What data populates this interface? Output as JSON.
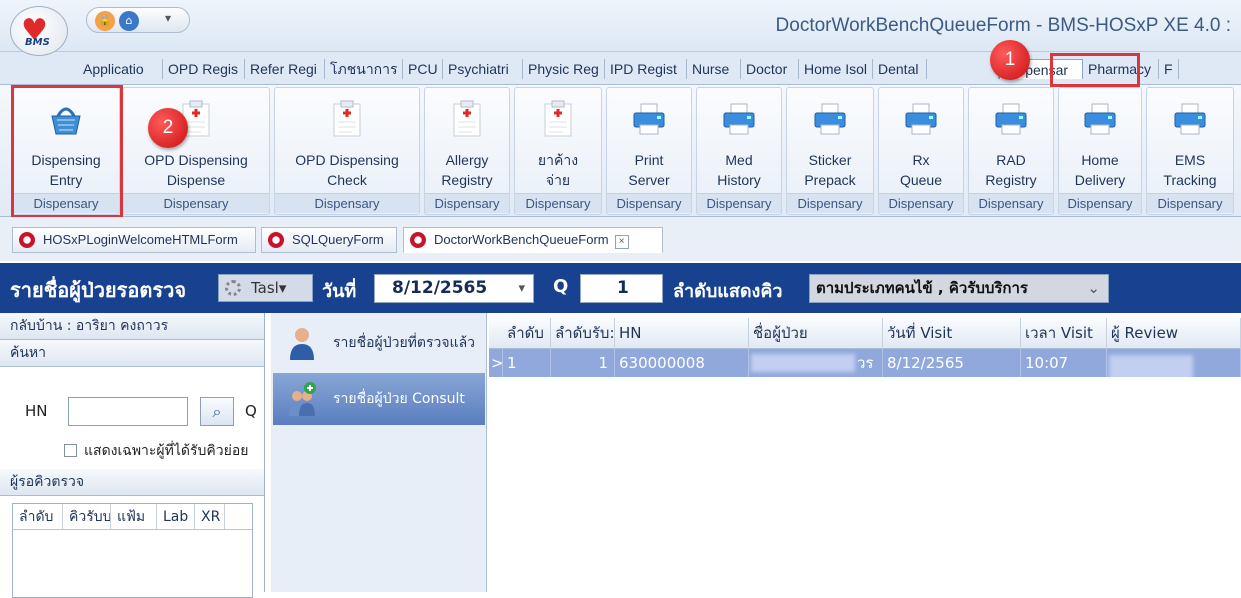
{
  "app": {
    "logo_text": "BMS",
    "window_title": "DoctorWorkBenchQueueForm - BMS-HOSxP XE 4.0 :"
  },
  "ribbon_tabs": [
    {
      "label": "Applicatio",
      "w": 85
    },
    {
      "label": "OPD Regis",
      "w": 82
    },
    {
      "label": "Refer Regi",
      "w": 80
    },
    {
      "label": "โภชนาการ",
      "w": 78
    },
    {
      "label": "PCU",
      "w": 40
    },
    {
      "label": "Psychiatri",
      "w": 80
    },
    {
      "label": "Physic Reg",
      "w": 82
    },
    {
      "label": "IPD Regist",
      "w": 82
    },
    {
      "label": "Nurse",
      "w": 54
    },
    {
      "label": "Doctor",
      "w": 58
    },
    {
      "label": "Home Isol",
      "w": 74
    },
    {
      "label": "Dental",
      "w": 54
    },
    {
      "label": "",
      "w": 72
    },
    {
      "label": "Dispensar",
      "w": 84
    },
    {
      "label": "Pharmacy",
      "w": 76
    },
    {
      "label": "F",
      "w": 20
    }
  ],
  "active_tab_label": "Dispensar",
  "ribbon_buttons": [
    {
      "name": "dispensing-entry",
      "label": "Dispensing\nEntry",
      "group": "Dispensary"
    },
    {
      "name": "opd-dispensing-dispense",
      "label": "OPD Dispensing\nDispense",
      "group": "Dispensary"
    },
    {
      "name": "opd-dispensing-check",
      "label": "OPD Dispensing\nCheck",
      "group": "Dispensary"
    },
    {
      "name": "allergy-registry",
      "label": "Allergy\nRegistry",
      "group": "Dispensary"
    },
    {
      "name": "drug-owed",
      "label": "ยาค้าง\nจ่าย",
      "group": "Dispensary"
    },
    {
      "name": "print-server",
      "label": "Print\nServer",
      "group": "Dispensary"
    },
    {
      "name": "med-history",
      "label": "Med\nHistory",
      "group": "Dispensary"
    },
    {
      "name": "sticker-prepack",
      "label": "Sticker\nPrepack",
      "group": "Dispensary"
    },
    {
      "name": "rx-queue",
      "label": "Rx\nQueue",
      "group": "Dispensary"
    },
    {
      "name": "rad-registry",
      "label": "RAD\nRegistry",
      "group": "Dispensary"
    },
    {
      "name": "home-delivery",
      "label": "Home\nDelivery",
      "group": "Dispensary"
    },
    {
      "name": "ems-tracking",
      "label": "EMS\nTracking",
      "group": "Dispensary"
    }
  ],
  "callouts": {
    "one": "1",
    "two": "2"
  },
  "doc_tabs": [
    {
      "label": "HOSxPLoginWelcomeHTMLForm"
    },
    {
      "label": "SQLQueryForm"
    },
    {
      "label": "DoctorWorkBenchQueueForm",
      "close": "×"
    }
  ],
  "queue_bar": {
    "title": "รายชื่อผู้ป่วยรอตรวจ",
    "task_label": "Tasl▾",
    "date_label": "วันที่",
    "date_value": "8/12/2565",
    "q_label": "Q",
    "q_value": "1",
    "sort_label": "ลำดับแสดงคิว",
    "sort_value": "ตามประเภทคนไข้ , คิวรับบริการ",
    "dropdown_icon": "⌄"
  },
  "left_panel": {
    "header": "กลับบ้าน : อาริยา คงถาวร",
    "search_header": "ค้นหา",
    "hn_label": "HN",
    "q_label": "Q",
    "checkbox_label": "แสดงเฉพาะผู้ที่ได้รับคิวย่อย",
    "queue_header": "ผู้รอคิวตรวจ",
    "queue_columns": [
      "ลำดับ",
      "คิวรับบ",
      "แฟ้ม",
      "Lab",
      "XR"
    ]
  },
  "nav_items": [
    {
      "label": "รายชื่อผู้ป่วยที่ตรวจแล้ว",
      "selected": false
    },
    {
      "label": "รายชื่อผู้ป่วย Consult",
      "selected": true
    }
  ],
  "grid": {
    "columns": [
      "ลำดับ",
      "ลำดับรับ:",
      "HN",
      "ชื่อผู้ป่วย",
      "วันที่ Visit",
      "เวลา Visit",
      "ผู้ Review"
    ],
    "rows": [
      {
        "indicator": ">",
        "seq": "1",
        "recv_seq": "1",
        "hn": "630000008",
        "name_tail": "วร",
        "visit_date": "8/12/2565",
        "visit_time": "10:07",
        "reviewer": ""
      }
    ]
  },
  "colors": {
    "accent": "#18418f",
    "highlight": "#d9363e",
    "selected_row": "#90a8dc"
  }
}
